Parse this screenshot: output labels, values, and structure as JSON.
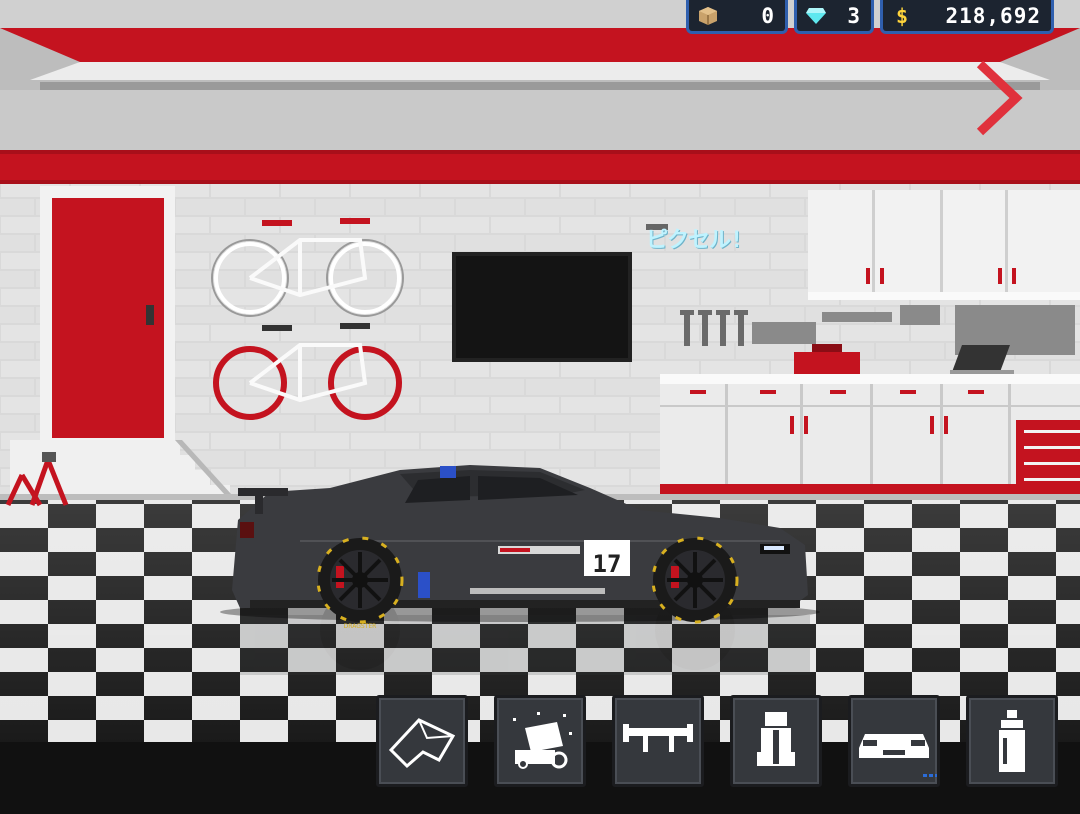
{
  "currency": {
    "crates": {
      "icon": "crate-icon",
      "value": "0"
    },
    "gems": {
      "icon": "diamond-icon",
      "value": "3"
    },
    "money": {
      "icon": "dollar-icon",
      "symbol": "$",
      "value": "218,692"
    }
  },
  "garage": {
    "wall_sign": "ピクセル!",
    "next_icon": "chevron-right-icon"
  },
  "car": {
    "race_number": "17",
    "tire_brand": "DRAGSTER"
  },
  "toolbar": {
    "buttons": [
      {
        "name": "wrap",
        "icon": "wrap-icon"
      },
      {
        "name": "wash",
        "icon": "car-wash-icon"
      },
      {
        "name": "spoiler",
        "icon": "spoiler-icon"
      },
      {
        "name": "seat",
        "icon": "seat-icon"
      },
      {
        "name": "body",
        "icon": "car-front-icon"
      },
      {
        "name": "paint",
        "icon": "spray-can-icon"
      }
    ]
  },
  "colors": {
    "accent_red": "#c4131f",
    "ui_border": "#2f5fae",
    "car_body": "#3a3b3f"
  }
}
